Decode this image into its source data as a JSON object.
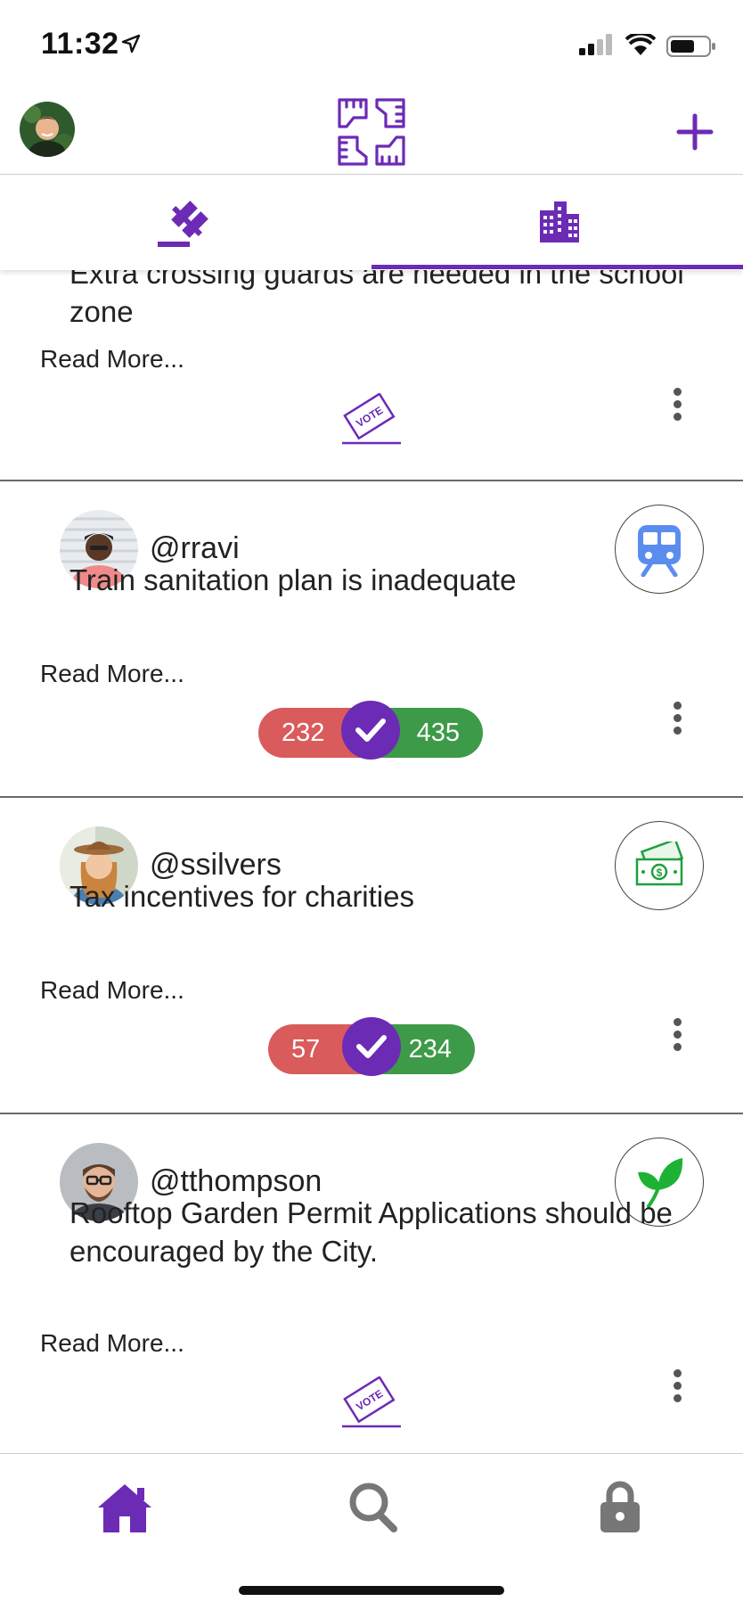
{
  "status_bar": {
    "time": "11:32"
  },
  "header": {
    "avatar_icon": "user-avatar",
    "logo_icon": "joined-hands-logo",
    "add_icon": "plus-icon"
  },
  "tabs": [
    {
      "icon": "gavel-icon",
      "active": false
    },
    {
      "icon": "city-building-icon",
      "active": true
    }
  ],
  "feed": {
    "posts": [
      {
        "username": "",
        "text": "Extra crossing guards are needed in the school zone",
        "read_more": "Read More...",
        "vote_label": "VOTE",
        "category_icon": ""
      },
      {
        "username": "@rravi",
        "text": "Train sanitation plan is inadequate",
        "read_more": "Read More...",
        "category_icon": "train-icon",
        "votes": {
          "against": "232",
          "for": "435"
        }
      },
      {
        "username": "@ssilvers",
        "text": "Tax incentives for charities",
        "read_more": "Read More...",
        "category_icon": "money-icon",
        "votes": {
          "against": "57",
          "for": "234"
        }
      },
      {
        "username": "@tthompson",
        "text": "Rooftop Garden Permit Applications should be encouraged by the City.",
        "read_more": "Read More...",
        "vote_label": "VOTE",
        "category_icon": "leaf-icon"
      }
    ]
  },
  "bottom_nav": [
    {
      "icon": "home-icon",
      "active": true
    },
    {
      "icon": "search-icon",
      "active": false
    },
    {
      "icon": "lock-icon",
      "active": false
    }
  ],
  "colors": {
    "accent": "#6c2bb5",
    "against": "#d95b5b",
    "for": "#3d9a48",
    "train": "#5b8def",
    "money": "#1fa03c",
    "leaf": "#1db233"
  }
}
